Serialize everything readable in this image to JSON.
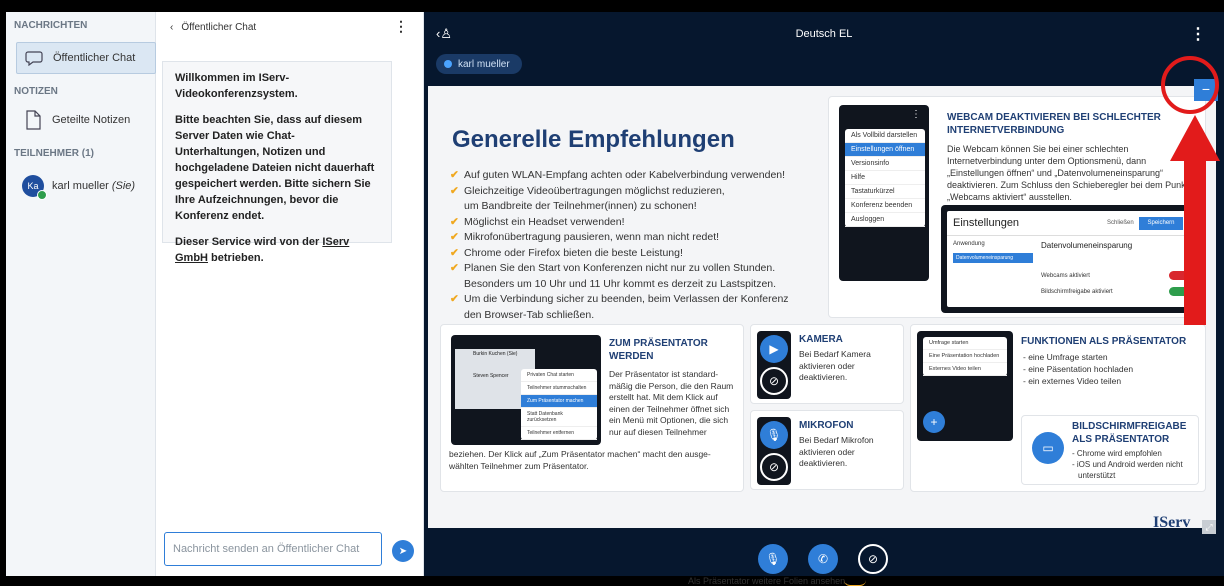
{
  "sidebar": {
    "sections": {
      "messages": "NACHRICHTEN",
      "notes": "NOTIZEN",
      "participants": "TEILNEHMER (1)"
    },
    "public_chat": "Öffentlicher Chat",
    "shared_notes": "Geteilte Notizen",
    "user": {
      "initials": "Ka",
      "name": "karl mueller",
      "self_tag": "(Sie)"
    }
  },
  "chat": {
    "header": "Öffentlicher Chat",
    "welcome_1": "Willkommen im IServ-Videokonferenzsystem.",
    "welcome_2": "Bitte beachten Sie, dass auf diesem Server Daten wie Chat-Unterhaltungen, Notizen und hochgeladene Dateien nicht dauerhaft gespeichert werden. Bitte sichern Sie Ihre Aufzeichnungen, bevor die Konferenz endet.",
    "welcome_3a": "Dieser Service wird von der ",
    "welcome_3b": "IServ GmbH",
    "welcome_3c": " betrieben.",
    "input_placeholder": "Nachricht senden an Öffentlicher Chat"
  },
  "conference": {
    "title": "Deutsch EL",
    "presenter": "karl mueller"
  },
  "slide": {
    "heading": "Generelle Empfehlungen",
    "tips": [
      "Auf guten WLAN-Empfang achten oder Kabelverbindung verwenden!",
      "Gleichzeitige Videoübertragungen möglichst reduzieren,",
      "um Bandbreite der Teilnehmer(innen) zu schonen!",
      "Möglichst ein Headset verwenden!",
      "Mikrofonübertragung pausieren, wenn man nicht redet!",
      "Chrome oder Firefox bieten die beste Leistung!",
      "Planen Sie den Start von Konferenzen nicht nur zu vollen Stunden.",
      "Besonders um 10 Uhr und 11 Uhr kommt es derzeit zu Lastspitzen.",
      "Um die Verbindung sicher zu beenden, beim Verlassen der Konferenz",
      "den Browser-Tab schließen."
    ],
    "webcam_title_1": "WEBCAM DEAKTIVIEREN BEI SCHLECHTER",
    "webcam_title_2": "INTERNETVERBINDUNG",
    "webcam_text": "Die Webcam können Sie bei einer schlechten Internetverbindung unter dem Optionsmenü, dann „Einstellungen öffnen“ und „Datenvolumeneinsparung“ deaktivieren. Zum Schluss den Schieberegler bei dem Punkt „Webcams aktiviert“ ausstellen.",
    "menu": [
      "Als Vollbild darstellen",
      "Einstellungen öffnen",
      "Versionsinfo",
      "Hilfe",
      "Tastaturkürzel",
      "Konferenz beenden",
      "Ausloggen"
    ],
    "settings_title": "Einstellungen",
    "settings_cancel": "Schließen",
    "settings_save": "Speichern",
    "settings_side": [
      "Anwendung",
      "Datenvolumeneinsparung"
    ],
    "settings_heading": "Datenvolumeneinsparung",
    "settings_webcams": "Webcams aktiviert",
    "settings_screenshare": "Bildschirmfreigabe aktiviert",
    "presenter_title_1": "ZUM PRÄSENTATOR",
    "presenter_title_2": "WERDEN",
    "presenter_text": "Der Präsentator ist standard-mäßig die Person, die den Raum erstellt hat. Mit dem Klick auf einen der Teilnehmer öffnet sich ein Menü mit Optionen, die sich nur auf diesen Teilnehmer",
    "presenter_text_2": "beziehen. Der Klick auf „Zum Präsentator machen“ macht den ausge-wählten Teilnehmer zum Präsentator.",
    "mini_users": [
      "Burkin Kuchen (Sie)",
      "Steven Spencer"
    ],
    "mini_menu": [
      "Privaten Chat starten",
      "Teilnehmer stummschalten",
      "Zum Präsentator machen",
      "Statt Datenbank zurücksetzen",
      "Teilnehmer entfernen"
    ],
    "camera_title": "KAMERA",
    "camera_text": "Bei Bedarf Kamera aktivieren oder deaktivieren.",
    "mic_title": "MIKROFON",
    "mic_text": "Bei Bedarf Mikrofon aktivieren oder deaktivieren.",
    "func_title": "FUNKTIONEN ALS PRÄSENTATOR",
    "func_items": [
      "- eine Umfrage starten",
      "- eine Päsentation hochladen",
      "- ein externes Video teilen"
    ],
    "func_menu": [
      "Umfrage starten",
      "Eine Präsentation hochladen",
      "Externes Video teilen"
    ],
    "share_title_1": "BILDSCHIRMFREIGABE",
    "share_title_2": "ALS PRÄSENTATOR",
    "share_items": [
      "- Chrome wird empfohlen",
      "- iOS und Android werden nicht",
      "unterstützt"
    ],
    "footnote": "Als Präsentator weitere Folien ansehen.",
    "logo": "IServ"
  }
}
